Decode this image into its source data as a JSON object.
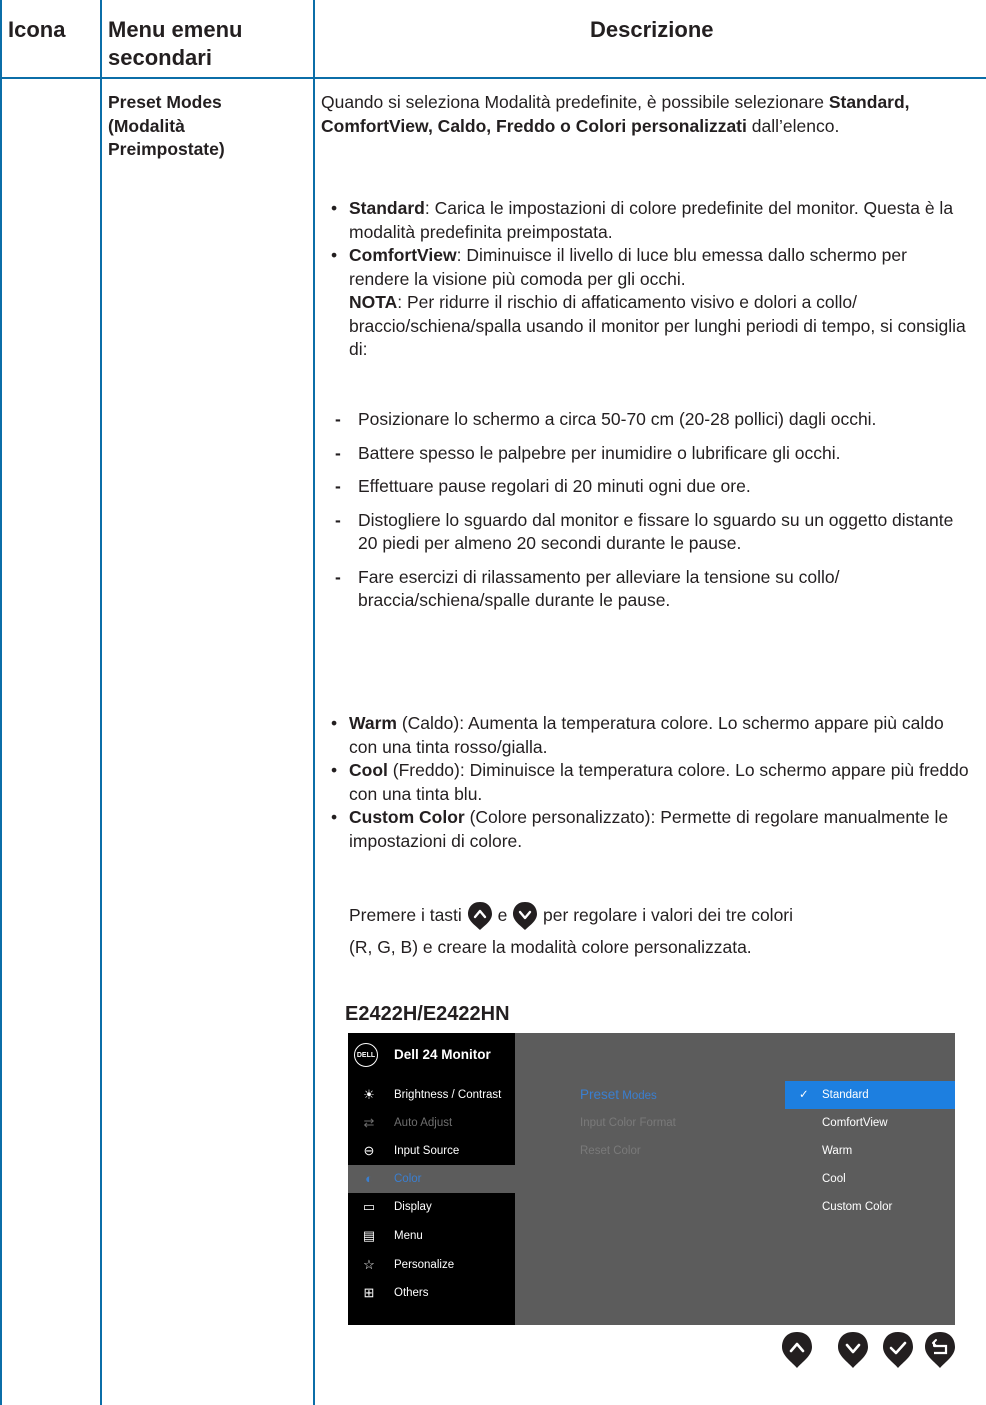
{
  "header": {
    "col_icon": "Icona",
    "col_submenu": "Menu emenu secondari",
    "col_description": "Descrizione"
  },
  "row": {
    "submenu_title": "Preset Modes (Modalità Preimpostate)",
    "intro_prefix": "Quando si seleziona Modalità predefinite, è possibile selezionare",
    "intro_bold": "Standard, ComfortView, Caldo, Freddo o Colori personalizzati",
    "intro_suffix": "dall’elenco.",
    "bullets_a": [
      {
        "term": "Standard",
        "text": ": Carica le impostazioni di colore predefinite del monitor. Questa è la modalità predefinita preimpostata."
      },
      {
        "term": "ComfortView",
        "text": ": Diminuisce il livello di luce blu emessa dallo schermo per rendere la visione più comoda per gli occhi."
      }
    ],
    "note_label": "NOTA",
    "note_text": ": Per ridurre il rischio di affaticamento visivo e dolori a collo/ braccio/schiena/spalla usando il monitor per lunghi periodi di tempo, si consiglia di:",
    "tips": [
      "Posizionare lo schermo a circa 50-70 cm (20-28 pollici) dagli occhi.",
      "Battere spesso le palpebre per inumidire o lubrificare gli occhi.",
      "Effettuare pause regolari di 20 minuti ogni due ore.",
      "Distogliere lo sguardo dal monitor e fissare lo sguardo su un oggetto distante 20 piedi per almeno 20 secondi durante le pause.",
      "Fare esercizi di rilassamento per alleviare la tensione su collo/ braccia/schiena/spalle durante le pause."
    ],
    "bullets_b": [
      {
        "term": "Warm",
        "text": " (Caldo): Aumenta la temperatura colore. Lo schermo appare più caldo con una tinta rosso/gialla."
      },
      {
        "term": "Cool",
        "text": " (Freddo): Diminuisce la temperatura colore. Lo schermo appare più freddo con una tinta blu."
      },
      {
        "term": "Custom Color",
        "text": " (Colore personalizzato): Permette di regolare manualmente le impostazioni di colore."
      }
    ],
    "press_prefix": "Premere i tasti",
    "press_and": "e",
    "press_suffix": "per regolare i valori dei tre colori",
    "press_line2": "(R, G, B) e creare la modalità colore personalizzata.",
    "model": "E2422H/E2422HN"
  },
  "osd": {
    "logo": "DELL",
    "title": "Dell 24 Monitor",
    "menu": [
      {
        "icon": "brightness-icon",
        "glyph": "☀",
        "label": "Brightness / Contrast",
        "state": "normal"
      },
      {
        "icon": "auto-adjust-icon",
        "glyph": "⇄",
        "label": "Auto Adjust",
        "state": "dim"
      },
      {
        "icon": "input-source-icon",
        "glyph": "⊖",
        "label": "Input Source",
        "state": "normal"
      },
      {
        "icon": "color-icon",
        "glyph": "◐",
        "label": "Color",
        "state": "active"
      },
      {
        "icon": "display-icon",
        "glyph": "▭",
        "label": "Display",
        "state": "normal"
      },
      {
        "icon": "menu-icon",
        "glyph": "▤",
        "label": "Menu",
        "state": "normal"
      },
      {
        "icon": "personalize-icon",
        "glyph": "☆",
        "label": "Personalize",
        "state": "normal"
      },
      {
        "icon": "others-icon",
        "glyph": "⊞",
        "label": "Others",
        "state": "normal"
      }
    ],
    "submenu": [
      {
        "label_a": "Preset",
        "label_b": "Modes",
        "state": "selected"
      },
      {
        "label_a": "Input Color Format",
        "label_b": "",
        "state": "dim"
      },
      {
        "label_a": "Reset Color",
        "label_b": "",
        "state": "dim"
      }
    ],
    "options": [
      {
        "label": "Standard",
        "selected": true
      },
      {
        "label": "ComfortView",
        "selected": false
      },
      {
        "label": "Warm",
        "selected": false
      },
      {
        "label": "Cool",
        "selected": false
      },
      {
        "label": "Custom Color",
        "selected": false
      }
    ],
    "colors": {
      "accent": "#1d7fe0",
      "active_text": "#3a7fd1",
      "table_line": "#0b6ea8"
    }
  }
}
